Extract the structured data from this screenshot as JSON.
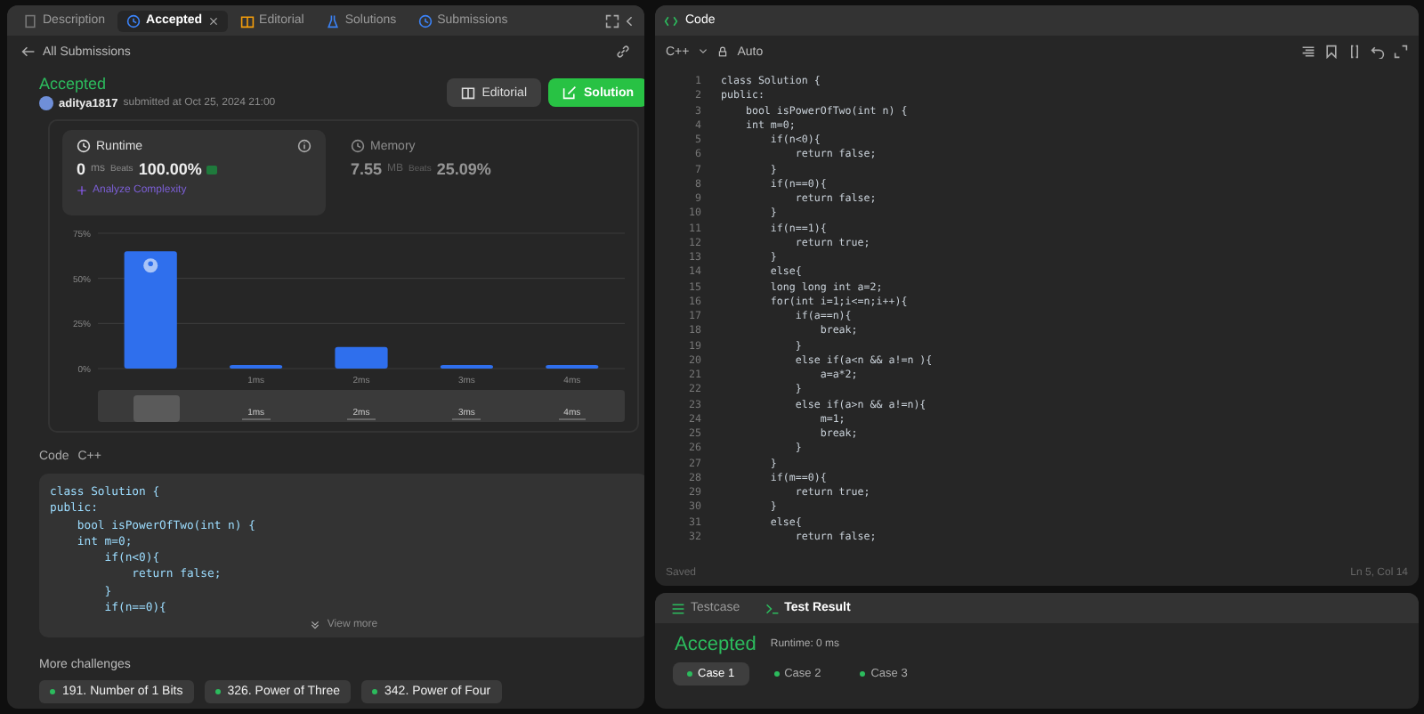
{
  "left_tabs": [
    {
      "label": "Description",
      "selected": false
    },
    {
      "label": "Accepted",
      "selected": true
    },
    {
      "label": "Editorial",
      "selected": false
    },
    {
      "label": "Solutions",
      "selected": false
    },
    {
      "label": "Submissions",
      "selected": false
    }
  ],
  "back_link": "All Submissions",
  "submission": {
    "status": "Accepted",
    "user": "aditya1817",
    "submitted": "submitted at Oct 25, 2024 21:00",
    "buttons": [
      {
        "label": "Editorial",
        "kind": "secondary"
      },
      {
        "label": "Solution",
        "kind": "primary"
      }
    ]
  },
  "stats": [
    {
      "title": "Runtime",
      "selected": true,
      "value": "0",
      "unit": "ms",
      "beats_label": "Beats",
      "beats": "100.00%",
      "link": "Analyze Complexity"
    },
    {
      "title": "Memory",
      "selected": false,
      "value": "7.55",
      "unit": "MB",
      "beats_label": "Beats",
      "beats": "25.09%"
    }
  ],
  "chart_data": {
    "type": "bar",
    "categories": [
      null,
      "1ms",
      "2ms",
      "3ms",
      "4ms"
    ],
    "values": [
      65,
      2,
      12,
      2,
      2
    ],
    "ylim": [
      0,
      75
    ],
    "yticks": [
      {
        "value": 0,
        "label": "0%"
      },
      {
        "value": 25,
        "label": "25%"
      },
      {
        "value": 50,
        "label": "50%"
      },
      {
        "value": 75,
        "label": "75%"
      }
    ]
  },
  "navigator_labels": [
    "1ms",
    "2ms",
    "3ms",
    "4ms"
  ],
  "code_preview": {
    "label": "Code",
    "language": "C++",
    "lines": [
      "class Solution {",
      "public:",
      "    bool isPowerOfTwo(int n) {",
      "    int m=0;",
      "        if(n<0){",
      "            return false;",
      "        }",
      "        if(n==0){"
    ],
    "more": "View more"
  },
  "more_challenges": {
    "title": "More challenges",
    "items": [
      "191. Number of 1 Bits",
      "326. Power of Three",
      "342. Power of Four"
    ]
  },
  "editor": {
    "title": "Code",
    "language": "C++",
    "mode": "Auto",
    "status": "Saved",
    "cursor": "Ln 5, Col 14",
    "lines": [
      "class Solution {",
      "public:",
      "    bool isPowerOfTwo(int n) {",
      "    int m=0;",
      "        if(n<0){",
      "            return false;",
      "        }",
      "        if(n==0){",
      "            return false;",
      "        }",
      "        if(n==1){",
      "            return true;",
      "        }",
      "        else{",
      "        long long int a=2;",
      "        for(int i=1;i<=n;i++){",
      "            if(a==n){",
      "                break;",
      "            }",
      "            else if(a<n && a!=n ){",
      "                a=a*2;",
      "            }",
      "            else if(a>n && a!=n){",
      "                m=1;",
      "                break;",
      "            }",
      "        }",
      "        if(m==0){",
      "            return true;",
      "        }",
      "        else{",
      "            return false;"
    ],
    "line_numbers": [
      "1",
      "2",
      "3",
      "4",
      "5",
      "6",
      "7",
      "8",
      "9",
      "10",
      "11",
      "12",
      "13",
      "14",
      "15",
      "16",
      "17",
      "18",
      "19",
      "20",
      "21",
      "22",
      "23",
      "24",
      "25",
      "26",
      "27",
      "28",
      "29",
      "30",
      "31",
      "32"
    ]
  },
  "result_tabs": [
    {
      "label": "Testcase",
      "selected": false
    },
    {
      "label": "Test Result",
      "selected": true
    }
  ],
  "result": {
    "status": "Accepted",
    "runtime": "Runtime: 0 ms",
    "cases": [
      {
        "label": "Case 1",
        "selected": true
      },
      {
        "label": "Case 2",
        "selected": false
      },
      {
        "label": "Case 3",
        "selected": false
      }
    ]
  }
}
